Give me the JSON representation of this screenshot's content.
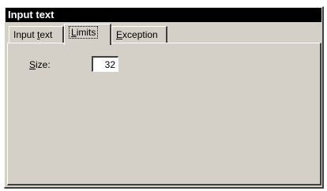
{
  "window": {
    "title": "Input text"
  },
  "tabs": {
    "input_text": {
      "pre": "Input ",
      "accel": "t",
      "post": "ext"
    },
    "limits": {
      "accel": "L",
      "post": "imits"
    },
    "exception": {
      "accel": "E",
      "post": "xception"
    }
  },
  "limits": {
    "size_label_accel": "S",
    "size_label_rest": "ize:",
    "size_value": "32"
  }
}
